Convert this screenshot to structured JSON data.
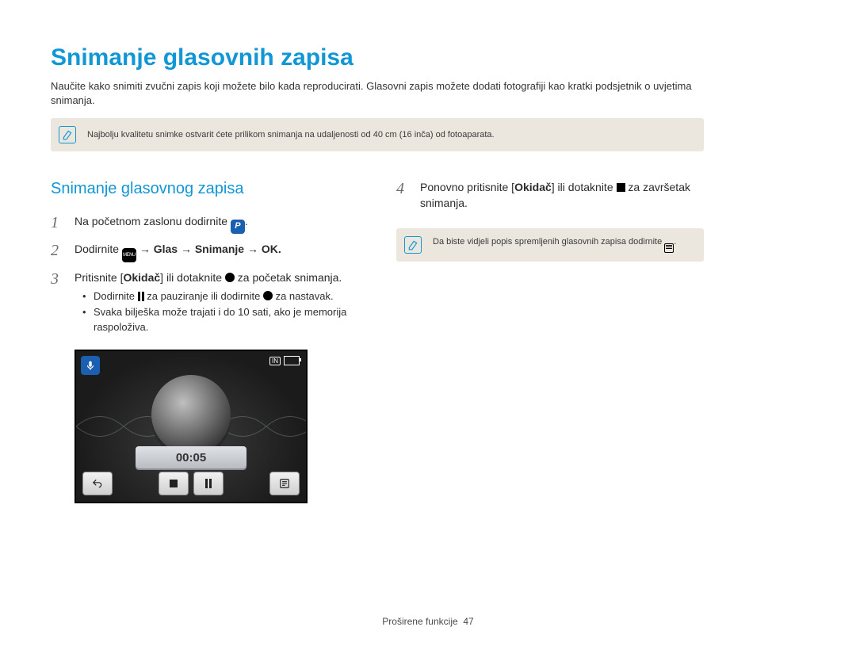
{
  "title": "Snimanje glasovnih zapisa",
  "intro": "Naučite kako snimiti zvučni zapis koji možete bilo kada reproducirati. Glasovni zapis možete dodati fotografiji kao kratki podsjetnik o uvjetima snimanja.",
  "note1": "Najbolju kvalitetu snimke ostvarit ćete prilikom snimanja na udaljenosti od 40 cm (16 inča) od fotoaparata.",
  "left": {
    "heading": "Snimanje glasovnog zapisa",
    "steps": {
      "s1_pre": "Na početnom zaslonu dodirnite ",
      "s2_pre": "Dodirnite ",
      "s2_glas": " → Glas → Snimanje → ",
      "s3_pre": "Pritisnite [",
      "s3_bold": "Okidač",
      "s3_mid": "] ili dotaknite ",
      "s3_post": " za početak snimanja.",
      "bullet1_pre": "Dodirnite ",
      "bullet1_mid": " za pauziranje ili dodirnite ",
      "bullet1_post": " za nastavak.",
      "bullet2": "Svaka bilješka može trajati i do 10 sati, ako je memorija raspoloživa."
    }
  },
  "right": {
    "s4_pre": "Ponovno pritisnite [",
    "s4_bold": "Okidač",
    "s4_mid": "] ili dotaknite ",
    "s4_post": " za završetak snimanja.",
    "note2": "Da biste vidjeli popis spremljenih glasovnih zapisa dodirnite "
  },
  "screen": {
    "timer": "00:05",
    "storage": "IN"
  },
  "footer": {
    "section": "Proširene funkcije",
    "page": "47"
  },
  "labels": {
    "menu": "MENU",
    "ok": "OK",
    "p": "P"
  }
}
